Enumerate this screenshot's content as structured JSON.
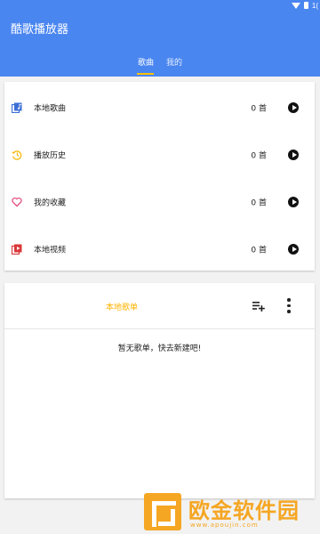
{
  "status_bar": {
    "time": "1("
  },
  "app": {
    "title": "酷歌播放器"
  },
  "tabs": [
    {
      "label": "歌曲",
      "active": true
    },
    {
      "label": "我的",
      "active": false
    }
  ],
  "library": {
    "items": [
      {
        "icon": "local-music-icon",
        "label": "本地歌曲",
        "count": "0 首"
      },
      {
        "icon": "history-icon",
        "label": "播放历史",
        "count": "0 首"
      },
      {
        "icon": "heart-icon",
        "label": "我的收藏",
        "count": "0 首"
      },
      {
        "icon": "video-icon",
        "label": "本地视频",
        "count": "0 首"
      }
    ]
  },
  "playlist": {
    "title": "本地歌单",
    "empty_text": "暂无歌单，快去新建吧!"
  },
  "watermark": {
    "title": "欧金软件园",
    "url": "www.apoujin.com"
  },
  "colors": {
    "appbar": "#4a86f0",
    "accent": "#ffc107",
    "local_music_icon": "#3d6fd6",
    "history_icon": "#f5b400",
    "heart_icon": "#e0457b",
    "video_icon": "#d9383a"
  }
}
